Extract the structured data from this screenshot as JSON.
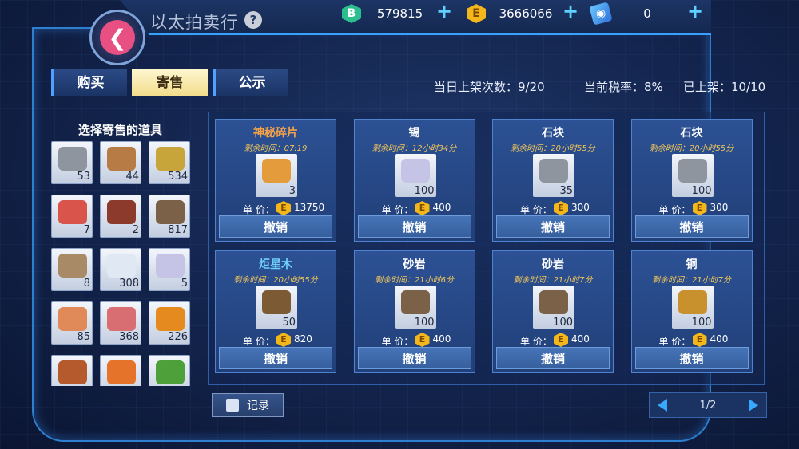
{
  "header": {
    "title": "以太拍卖行",
    "help": "?",
    "currencies": [
      {
        "icon": "b-coin-icon",
        "letter": "B",
        "value": "579815"
      },
      {
        "icon": "e-coin-icon",
        "letter": "E",
        "value": "3666066"
      },
      {
        "icon": "ticket-icon",
        "letter": "",
        "value": "0"
      }
    ]
  },
  "tabs": [
    {
      "label": "购买",
      "active": false
    },
    {
      "label": "寄售",
      "active": true
    },
    {
      "label": "公示",
      "active": false
    }
  ],
  "stats": {
    "daily_listings": "当日上架次数：9/20",
    "tax_rate": "当前税率：8%",
    "listed": "已上架：10/10"
  },
  "inventory": {
    "title": "选择寄售的道具",
    "items": [
      {
        "icon": "stone-icon",
        "count": "53",
        "color": "#8f959e"
      },
      {
        "icon": "wood-icon",
        "count": "44",
        "color": "#b77b46"
      },
      {
        "icon": "wheat-icon",
        "count": "534",
        "color": "#c7a53a"
      },
      {
        "icon": "meat-icon",
        "count": "7",
        "color": "#d9544a"
      },
      {
        "icon": "antler-icon",
        "count": "2",
        "color": "#8b3a2b"
      },
      {
        "icon": "sandstone-icon",
        "count": "817",
        "color": "#7a6147"
      },
      {
        "icon": "hide-icon",
        "count": "8",
        "color": "#a88b66"
      },
      {
        "icon": "salt-icon",
        "count": "308",
        "color": "#dfe8f3"
      },
      {
        "icon": "crystal-icon",
        "count": "5",
        "color": "#c6c4e6"
      },
      {
        "icon": "drumstick-icon",
        "count": "85",
        "color": "#e08a5a"
      },
      {
        "icon": "ham-icon",
        "count": "368",
        "color": "#d96e72"
      },
      {
        "icon": "pumpkin-icon",
        "count": "226",
        "color": "#e58a1e"
      },
      {
        "icon": "mushroom-icon",
        "count": "",
        "color": "#b55a2c"
      },
      {
        "icon": "carrot-icon",
        "count": "",
        "color": "#e6732a"
      },
      {
        "icon": "herb-icon",
        "count": "",
        "color": "#4ea03a"
      }
    ]
  },
  "listings": {
    "price_label": "单  价：",
    "cancel_label": "撤销",
    "items": [
      {
        "name": "神秘碎片",
        "remaining": "剩余时间：07:19",
        "count": "3",
        "price": "13750",
        "name_color": "#f5a24a",
        "icon": "mystery-shard-icon",
        "color": "#e49b3c"
      },
      {
        "name": "锡",
        "remaining": "剩余时间：12小时34分",
        "count": "100",
        "price": "400",
        "name_color": "#ffffff",
        "icon": "tin-icon",
        "color": "#c6c4e6"
      },
      {
        "name": "石块",
        "remaining": "剩余时间：20小时55分",
        "count": "35",
        "price": "300",
        "name_color": "#ffffff",
        "icon": "stone-icon",
        "color": "#8f959e"
      },
      {
        "name": "石块",
        "remaining": "剩余时间：20小时55分",
        "count": "100",
        "price": "300",
        "name_color": "#ffffff",
        "icon": "stone-icon",
        "color": "#8f959e"
      },
      {
        "name": "炬星木",
        "remaining": "剩余时间：20小时55分",
        "count": "50",
        "price": "820",
        "name_color": "#6fd0ff",
        "icon": "star-wood-icon",
        "color": "#7b5a34"
      },
      {
        "name": "砂岩",
        "remaining": "剩余时间：21小时6分",
        "count": "100",
        "price": "400",
        "name_color": "#ffffff",
        "icon": "sandstone-icon",
        "color": "#7a6147"
      },
      {
        "name": "砂岩",
        "remaining": "剩余时间：21小时7分",
        "count": "100",
        "price": "400",
        "name_color": "#ffffff",
        "icon": "sandstone-icon",
        "color": "#7a6147"
      },
      {
        "name": "铜",
        "remaining": "剩余时间：21小时7分",
        "count": "100",
        "price": "400",
        "name_color": "#ffffff",
        "icon": "copper-icon",
        "color": "#c9912e"
      }
    ]
  },
  "footer": {
    "record_label": "记录",
    "page": "1/2"
  }
}
